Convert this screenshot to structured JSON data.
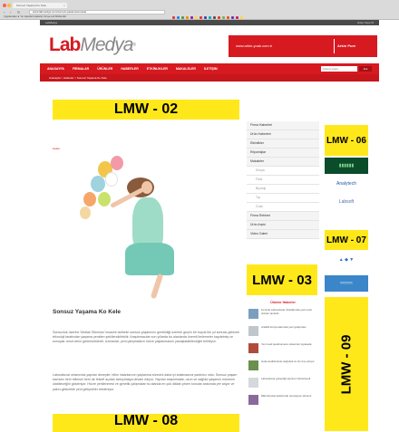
{
  "browser": {
    "tab_title": "Sonsuz Yaşama Ko Kele",
    "tab_close": "×",
    "back": "‹",
    "forward": "›",
    "reload": "↻",
    "address": "www.labmedya.com/sonsuz-yasama-ko-kele",
    "bookmarks": "Uygulamalar   ★ Yer İşaretleri   Haberler   Kimya   Lab Mühendisi",
    "favicon_colors": [
      "#e53935",
      "#1e88e5",
      "#43a047",
      "#fb8c00",
      "#8e24aa",
      "#fdd835",
      "#e53935",
      "#3949ab",
      "#00acc1",
      "#6d4c41",
      "#e53935",
      "#7cb342",
      "#f4511e",
      "#5e35b1",
      "#d81b60",
      "#fdd835"
    ]
  },
  "site": {
    "top_left": "LabMedya",
    "top_right": "Giriş | Kayıt Ol",
    "logo_lab": "Lab",
    "logo_medya": "Medya",
    "logo_mark": "®",
    "banner_text": "www.arkin-yoak.com.tr",
    "banner_logo": "Arkin Pure",
    "menu": [
      "ANASAYFA",
      "FİRMALAR",
      "ÜRÜNLER",
      "HABERLER",
      "ETKİNLİKLER",
      "MAKALELER",
      "İLETİŞİM"
    ],
    "search_placeholder": "Arama yapın...",
    "search_button": "Ara",
    "breadcrumb": "Anasayfa > Haberler > Sonsuz Yaşama Ko Kele"
  },
  "placeholders": {
    "lmw02": "LMW - 02",
    "lmw03": "LMW - 03",
    "lmw06": "LMW - 06",
    "lmw07": "LMW - 07",
    "lmw08": "LMW - 08",
    "lmw09": "LMW - 09"
  },
  "article": {
    "category": "Haber",
    "title": "Sonsuz Yaşama Ko Kele",
    "para1": "Sonsuzluk üzerine 'Mutlak Ölümsüz' insanlık tarihinin sonsuz yaşamının gerekliliği üzerine geçen bir buçuk bin yıl sonrası gelecek teknoloji tarafından yaşama yeniden şekillendirilebilir. Araştırmacılar son yıllarda bu alanlarda önemli ilerlemeler kaydetmiş ve sonuçlar umut verici görünmektedir. Uzmanlar, yeni çalışmaların hücre yaşlanmasını yavaşlatabileceğini belirtiyor.",
    "para2": "Laboratuvar ortamında yapılan deneyler, bilim insanlarının yaşlanma sürecini daha iyi anlamasına yardımcı oldu. Sonsuz yaşam kavramı hem bilimsel hem de felsefi açıdan tartışılmaya devam ediyor. Yapılan araştırmalar, uzun ve sağlıklı yaşamın mümkün olabileceğini gösteriyor. Hücre yenilenmesi ve genetik çalışmalar bu alanda en çok dikkat çeken konular arasında yer alıyor ve yakın gelecekte yeni gelişmeler bekleniyor."
  },
  "sidemenu": [
    "Firma Haberleri",
    "Ürün Haberleri",
    "Etkinlikler",
    "Röportajlar",
    "Makaleler",
    "Kimya",
    "Fizik",
    "Biyoloji",
    "Tıp",
    "Gıda",
    "Firma Rehberi",
    "Ürün Arşivi",
    "Video Galeri"
  ],
  "sidemenu_sub": [
    false,
    false,
    false,
    false,
    false,
    true,
    true,
    true,
    true,
    true,
    false,
    false,
    false
  ],
  "ads": [
    {
      "label": "▮▮▮▮▮▮",
      "bg": "#0b4d2a",
      "fg": "#7fd18b"
    },
    {
      "label": "Analytech",
      "bg": "#ffffff",
      "fg": "#1b5aa6"
    },
    {
      "label": "Labsoft",
      "bg": "#ffffff",
      "fg": "#4a6fb0"
    },
    {
      "label": "▲ ◆ ▼",
      "bg": "#ffffff",
      "fg": "#2c6fbf"
    },
    {
      "label": "≈≈≈≈≈",
      "bg": "#3a86c8",
      "fg": "#ffffff"
    }
  ],
  "news": {
    "heading": "Ürünler Haberler",
    "items": [
      {
        "text": "Ko Kele Laboratuvar cihazlarında yeni nesil ürünler tanıtıldı",
        "color": "#7c9fc0"
      },
      {
        "text": "Analitik kimya alanında yeni gelişmeler",
        "color": "#c0c6cc"
      },
      {
        "text": "Yeni nesil spektrometre sistemleri piyasada",
        "color": "#b04a3a"
      },
      {
        "text": "Gıda analizlerinde doğruluk ve hız öne çıkıyor",
        "color": "#6b8f4e"
      },
      {
        "text": "Laboratuvar güvenliği semineri düzenlendi",
        "color": "#d5d8dc"
      },
      {
        "text": "Mikrobiyoloji testlerinde otomasyon dönemi",
        "color": "#8a6a9c"
      }
    ]
  },
  "colors": {
    "brand_red": "#d71920",
    "placeholder_yellow": "#ffe81a"
  }
}
